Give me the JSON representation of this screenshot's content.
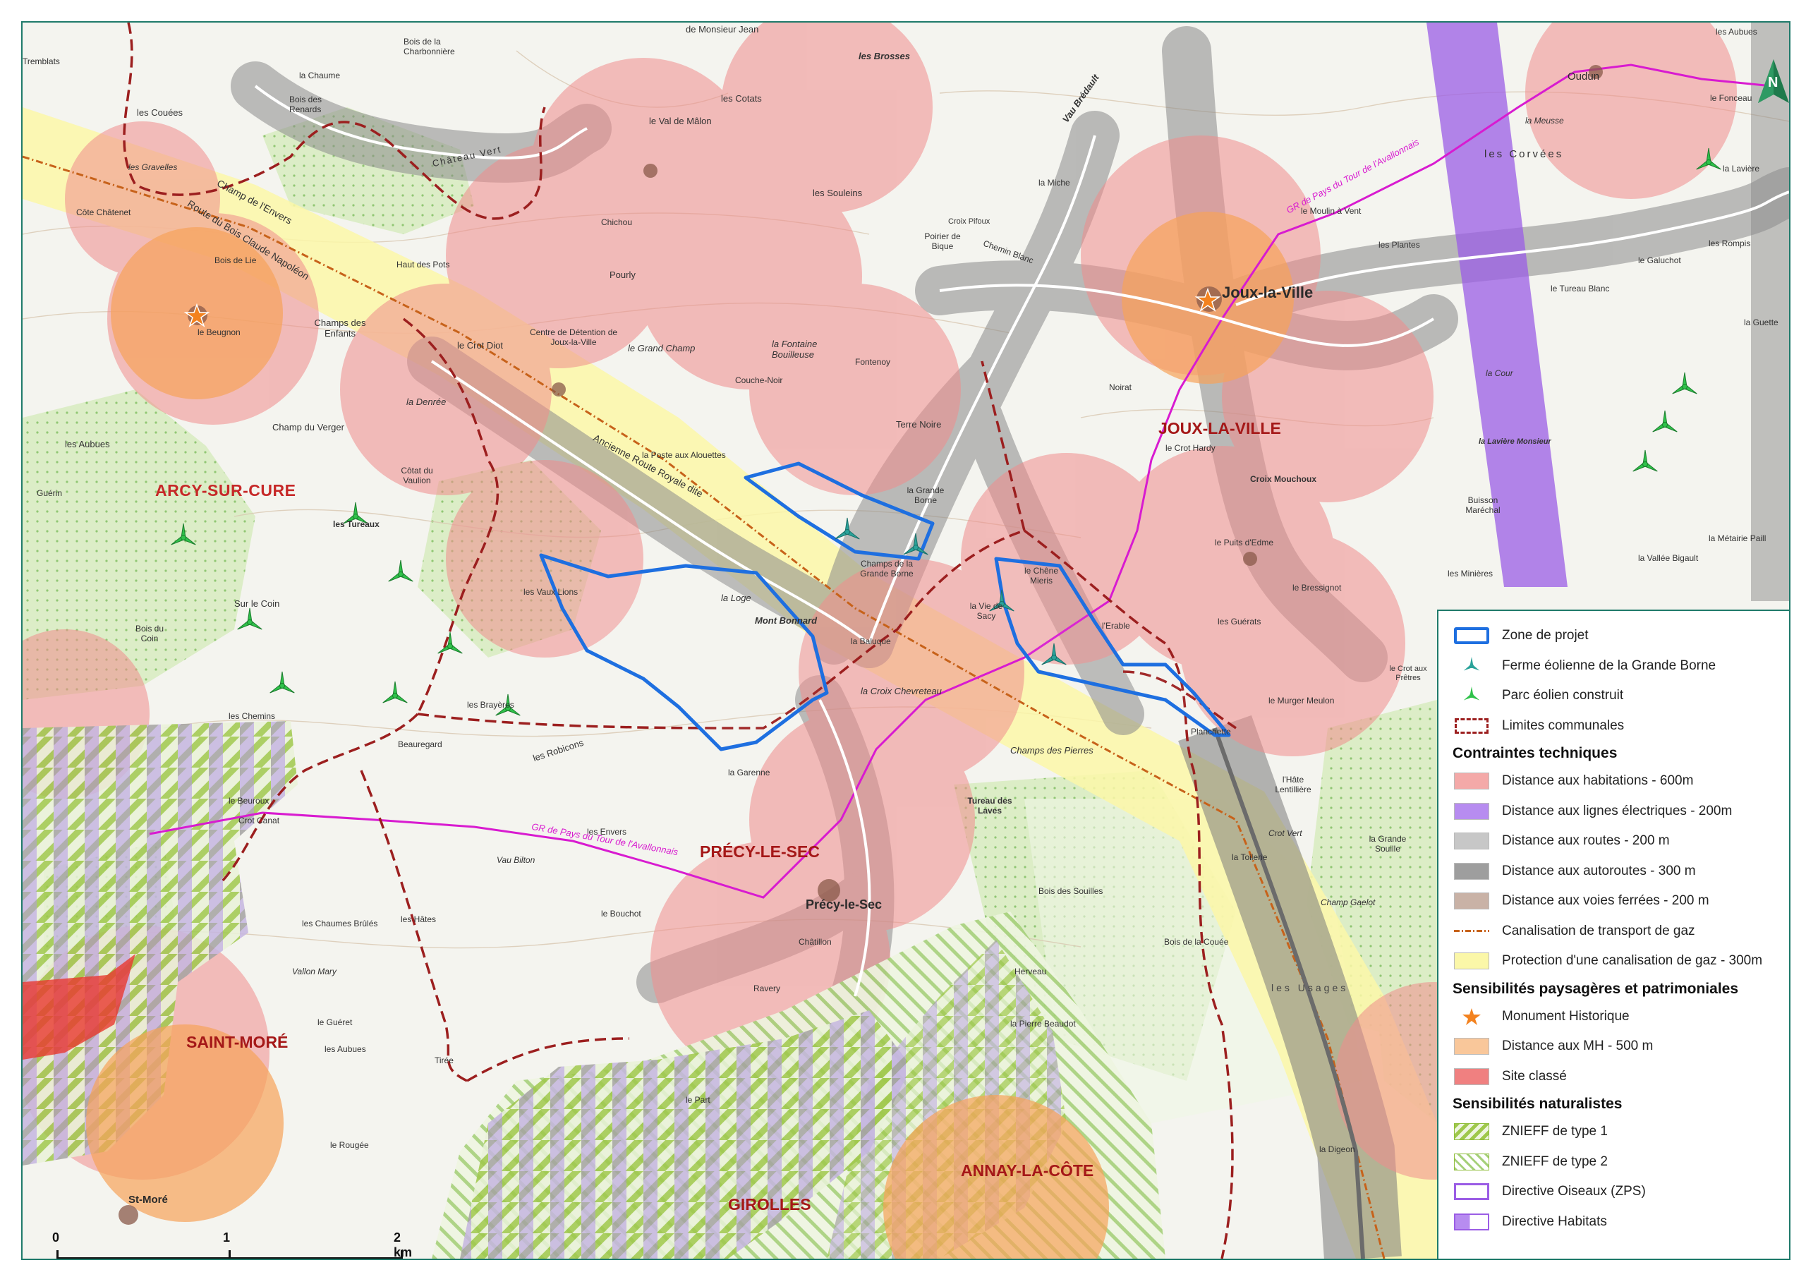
{
  "communes": [
    "ARCY-SUR-CURE",
    "JOUX-LA-VILLE",
    "PRÉCY-LE-SEC",
    "SAINT-MORÉ",
    "ANNAY-LA-CÔTE",
    "GIROLLES"
  ],
  "places": {
    "joux_town": "Joux-la-Ville",
    "precy_town": "Précy-le-Sec",
    "st_more": "St-Moré",
    "oudun": "Oudun",
    "les_brosses": "les Brosses",
    "le_val_de_malon": "le Val de Mâlon",
    "les_souleins": "les Souleins",
    "pourly": "Pourly",
    "le_grand_champ": "le Grand Champ",
    "la_fontaine": "la Fontaine Bouilleuse",
    "terre_noire": "Terre Noire",
    "centre_detention": "Centre de Détention de Joux-la-Ville",
    "le_crot_diot": "le Crot Diot",
    "la_denree": "la Denrée",
    "champ_du_verger": "Champ du Verger",
    "les_aubues": "les Aubues",
    "les_couees": "les Couées",
    "le_beugnon": "le Beugnon",
    "champs_des_enfants": "Champs des Enfants",
    "haut_des_pots": "Haut des Pots",
    "cotat_du_vaulion": "Côtat du Vaulion",
    "les_tureaux": "les Tureaux",
    "sur_le_coin": "Sur le Coin",
    "bois_du_coin": "Bois du Coin",
    "les_brayeres": "les Brayères",
    "les_chemins": "les Chemins",
    "beauregard": "Beauregard",
    "les_robicons": "les Robicons",
    "le_beuroux": "le Beuroux",
    "crot_canat": "Crot Canat",
    "les_envers": "les Envers",
    "les_vaux_lions": "les Vaux Lions",
    "la_loge": "la Loge",
    "mont_bonnard": "Mont Bonnard",
    "champs_grande_borne": "Champs de la Grande Borne",
    "la_grande_borne": "la Grande Borne",
    "la_vie_de_sacy": "la Vie de Sacy",
    "le_chene_mieris": "le Chêne Mieris",
    "la_baluque": "la Baluque",
    "la_croix_chevreteau": "la Croix Chevreteau",
    "champs_des_pierres": "Champs des Pierres",
    "tureau_des_laves": "Tureau des Laves",
    "la_garenne": "la Garenne",
    "le_bouchot": "le Bouchot",
    "chatillon": "Châtillon",
    "ravery": "Ravery",
    "les_hates": "les Hâtes",
    "les_chaumes_brules": "les Chaumes Brûlés",
    "le_gueret": "le Guéret",
    "les_aubues2": "les Aubues",
    "le_rougee": "le Rougée",
    "le_part": "le Part",
    "la_pierre_beaudot": "la Pierre Beaudot",
    "herveau": "Herveau",
    "bois_des_souilles": "Bois des Souilles",
    "bois_de_la_couee": "Bois de la Couée",
    "la_digeon": "la Digeon",
    "noirat": "Noirat",
    "le_crot_hardy": "le Crot Hardy",
    "croix_mouchoux": "Croix Mouchoux",
    "le_puits_dedme": "le Puits d'Edme",
    "le_bressignot": "le Bressignot",
    "les_guerats": "les Guérats",
    "lerable": "l'Erable",
    "le_murger_meulon": "le Murger Meulon",
    "planchette": "Planchette",
    "lhate_lentilliere": "l'Hâte Lentillière",
    "la_toilerie": "la Toilerie",
    "la_grande_souille": "la Grande Souille",
    "champ_gaelot": "Champ Gaelot",
    "crot_vert": "Crot Vert",
    "la_cour": "la Cour",
    "la_laviere_monsieur": "la Lavière Monsieur",
    "buisson_marechal": "Buisson Maréchal",
    "les_minieres": "les Minières",
    "la_vallee_bigault": "la Vallée Bigault",
    "la_metairie_paill": "la Métairie Paill",
    "les_rompis": "les Rompis",
    "le_galuchot": "le Galuchot",
    "le_tureau_blanc": "le Tureau Blanc",
    "la_guette": "la Guette",
    "les_plantes": "les Plantes",
    "le_moulin_a_vent": "le Moulin à Vent",
    "les_corvees": "les Corvées",
    "la_meusse": "la Meusse",
    "le_fonceau": "le Fonceau",
    "les_aubues3": "les Aubues",
    "la_laviere": "la Lavière",
    "la_miche": "la Miche",
    "poirier_de_bique": "Poirier de Bique",
    "croix_pifoux": "Croix Pifoux",
    "chemin_blanc": "Chemin Blanc",
    "vau_bredault": "Vau Brédault",
    "chateau_vert": "Château Vert",
    "la_chaume": "la Chaume",
    "bois_des_renards": "Bois des Renards",
    "bois_charbonniere": "Bois de la Charbonnière",
    "bois_de_lie": "Bois de Lie",
    "guerin": "Guérin",
    "le_crot_aux_pretres": "le Crot aux Prêtres",
    "la_poste_aux_alouettes": "la Poste aux Alouettes",
    "couche_noir": "Couche-Noir",
    "fontenoy": "Fontenoy",
    "chichou": "Chichou",
    "les_cotats": "les Cotats",
    "de_monsieur_jean": "de Monsieur Jean",
    "tremblats": "Tremblats",
    "les_gravelles": "les Gravelles",
    "cote_chatenet": "Côte Châtenet",
    "champ_de_lenvers": "Champ de l'Envers",
    "route_napoleon": "Route du Bois Claude Napoléon",
    "ancienne_route_royale": "Ancienne Route Royale dite",
    "gr_label": "GR de Pays du Tour de l'Avallonnais",
    "gr_label2": "GR de Pays du Tour de l'Avallonnais",
    "vau_bilton": "Vau Bilton",
    "vallon_mary": "Vallon Mary",
    "les_usages": "les Usages",
    "tirée": "Tirée"
  },
  "scale": {
    "zero": "0",
    "one": "1",
    "two": "2 km"
  },
  "north": {
    "letter": "N"
  },
  "legend": {
    "items_top": [
      {
        "label": "Zone de projet",
        "sym": "zone"
      },
      {
        "label": "Ferme éolienne de la Grande Borne",
        "sym": "turbine-teal"
      },
      {
        "label": "Parc éolien construit",
        "sym": "turbine-green"
      },
      {
        "label": "Limites communales",
        "sym": "commune-limit"
      }
    ],
    "section1": "Contraintes techniques",
    "items_1": [
      {
        "label": "Distance aux habitations - 600m",
        "sym": "fill",
        "color": "#f4a9a8"
      },
      {
        "label": "Distance aux lignes électriques - 200m",
        "sym": "fill",
        "color": "#b78cf0"
      },
      {
        "label": "Distance aux routes - 200 m",
        "sym": "fill",
        "color": "#c7c7c7"
      },
      {
        "label": "Distance aux autoroutes - 300 m",
        "sym": "fill",
        "color": "#9e9e9e"
      },
      {
        "label": "Distance aux voies ferrées - 200 m",
        "sym": "fill",
        "color": "#c9b2a6"
      },
      {
        "label": "Canalisation de transport de gaz",
        "sym": "gas-line"
      },
      {
        "label": "Protection d'une canalisation de gaz - 300m",
        "sym": "fill",
        "color": "#fbf7a8"
      }
    ],
    "section2": "Sensibilités paysagères et patrimoniales",
    "items_2": [
      {
        "label": "Monument Historique",
        "sym": "star"
      },
      {
        "label": "Distance aux MH - 500 m",
        "sym": "fill",
        "color": "#f9c79a"
      },
      {
        "label": "Site classé",
        "sym": "fill",
        "color": "#f08080"
      }
    ],
    "section3": "Sensibilités naturalistes",
    "items_3": [
      {
        "label": "ZNIEFF de type 1",
        "sym": "hatch1"
      },
      {
        "label": "ZNIEFF de type 2",
        "sym": "hatch2"
      },
      {
        "label": "Directive Oiseaux (ZPS)",
        "sym": "outline-purple"
      },
      {
        "label": "Directive Habitats",
        "sym": "half-purple"
      }
    ]
  },
  "colors": {
    "habitation": "#f08c8c",
    "mh": "#f6a35a",
    "route": "#8a8a8a",
    "electric": "#9b5de5",
    "gas": "#fdf59a",
    "zone": "#1e6fe0",
    "turbine_teal": "#2aa39a",
    "turbine_green": "#2fc24a",
    "limit": "#9c1f1f",
    "gr": "#d81bd0",
    "znieff": "#8fbd3a"
  }
}
